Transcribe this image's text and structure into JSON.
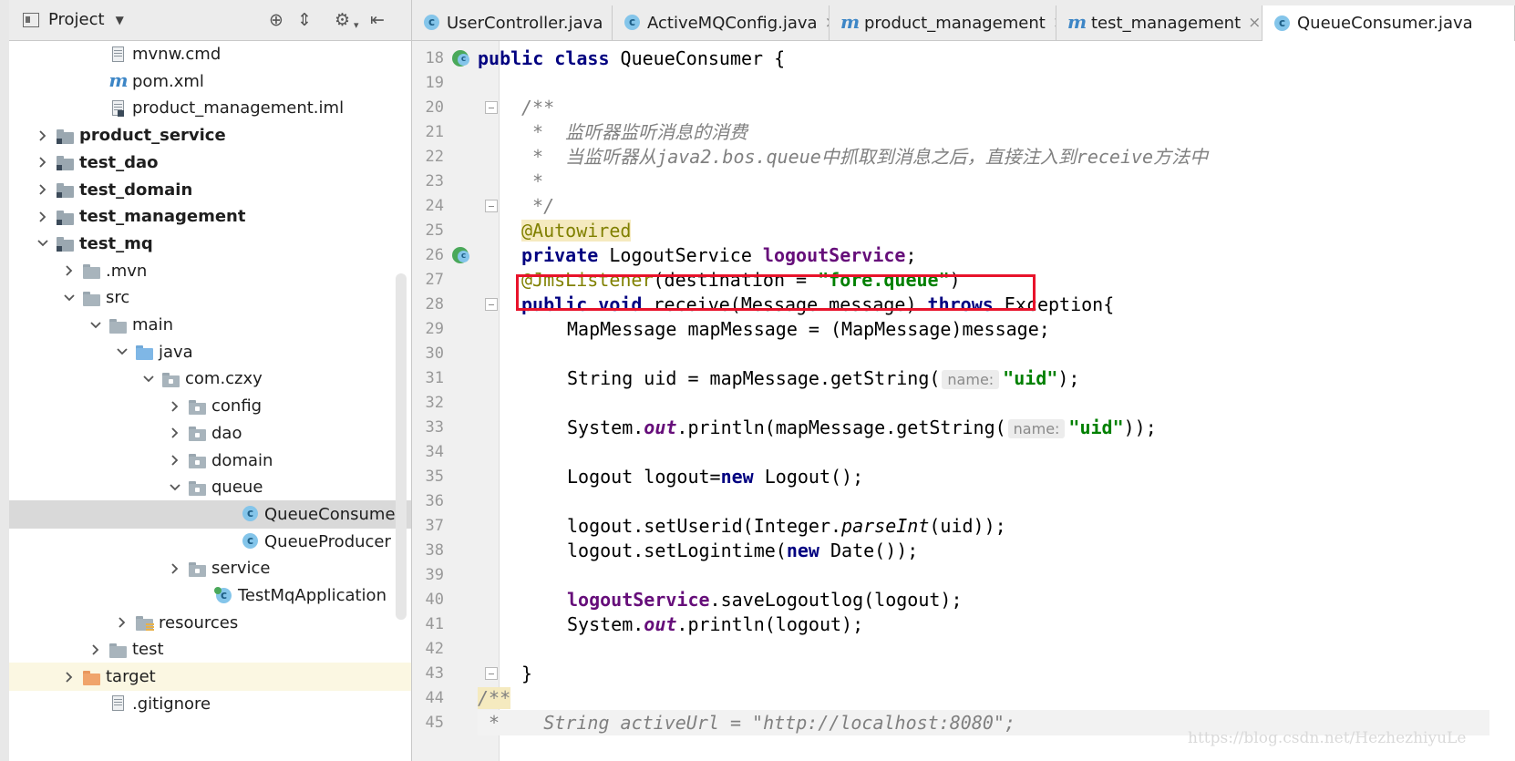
{
  "project_panel": {
    "title": "Project",
    "tree": [
      {
        "label": "mvnw.cmd",
        "icon": "file-icon"
      },
      {
        "label": "pom.xml",
        "icon": "maven-icon"
      },
      {
        "label": "product_management.iml",
        "icon": "iml-file-icon"
      },
      {
        "label": "product_service",
        "icon": "module-folder-icon"
      },
      {
        "label": "test_dao",
        "icon": "module-folder-icon"
      },
      {
        "label": "test_domain",
        "icon": "module-folder-icon"
      },
      {
        "label": "test_management",
        "icon": "module-folder-icon"
      },
      {
        "label": "test_mq",
        "icon": "module-folder-icon"
      },
      {
        "label": ".mvn",
        "icon": "folder-icon"
      },
      {
        "label": "src",
        "icon": "folder-icon"
      },
      {
        "label": "main",
        "icon": "folder-icon"
      },
      {
        "label": "java",
        "icon": "source-folder-icon"
      },
      {
        "label": "com.czxy",
        "icon": "package-icon"
      },
      {
        "label": "config",
        "icon": "package-icon"
      },
      {
        "label": "dao",
        "icon": "package-icon"
      },
      {
        "label": "domain",
        "icon": "package-icon"
      },
      {
        "label": "queue",
        "icon": "package-icon"
      },
      {
        "label": "QueueConsumer",
        "icon": "class-icon",
        "selected": true
      },
      {
        "label": "QueueProducer",
        "icon": "class-icon"
      },
      {
        "label": "service",
        "icon": "package-icon"
      },
      {
        "label": "TestMqApplication",
        "icon": "spring-boot-class-icon"
      },
      {
        "label": "resources",
        "icon": "resources-folder-icon"
      },
      {
        "label": "test",
        "icon": "folder-icon"
      },
      {
        "label": "target",
        "icon": "target-folder-icon"
      },
      {
        "label": ".gitignore",
        "icon": "file-icon"
      }
    ]
  },
  "tabs": [
    {
      "label": "UserController.java",
      "icon": "class-icon"
    },
    {
      "label": "ActiveMQConfig.java",
      "icon": "class-icon"
    },
    {
      "label": "product_management",
      "icon": "maven-icon"
    },
    {
      "label": "test_management",
      "icon": "maven-icon"
    },
    {
      "label": "QueueConsumer.java",
      "icon": "class-icon",
      "active": true
    }
  ],
  "editor": {
    "line_numbers": [
      "18",
      "19",
      "20",
      "21",
      "22",
      "23",
      "24",
      "25",
      "26",
      "27",
      "28",
      "29",
      "30",
      "31",
      "32",
      "33",
      "34",
      "35",
      "36",
      "37",
      "38",
      "39",
      "40",
      "41",
      "42",
      "43",
      "44",
      "45"
    ],
    "code": {
      "l18": {
        "k1": "public",
        "k2": "class",
        "rest": " QueueConsumer {"
      },
      "l20": "/**",
      "l21": " *  监听器监听消息的消费",
      "l22": " *  当监听器从java2.bos.queue中抓取到消息之后，直接注入到receive方法中",
      "l23": " *",
      "l24": " */",
      "l25": "@Autowired",
      "l26": {
        "k1": "private",
        "type": " LogoutService ",
        "field": "logoutService",
        "end": ";"
      },
      "l27": {
        "ann": "@JmsListener",
        "mid": "(destination = ",
        "str": "\"fore.queue\"",
        "end": ")"
      },
      "l28": {
        "k1": "public",
        "k2": "void",
        "mid": " receive(Message message) ",
        "k3": "throws",
        "end": " Exception{"
      },
      "l29": "MapMessage mapMessage = (MapMessage)message;",
      "l31": {
        "pre": "String uid = mapMessage.getString(",
        "hint": "name:",
        "str": "\"uid\"",
        "end": ");"
      },
      "l33": {
        "pre": "System.",
        "out": "out",
        "mid": ".println(mapMessage.getString(",
        "hint": "name:",
        "str": "\"uid\"",
        "end": "));"
      },
      "l35": {
        "pre": "Logout logout=",
        "k": "new",
        "end": " Logout();"
      },
      "l37": {
        "pre": "logout.setUserid(Integer.",
        "it": "parseInt",
        "end": "(uid));"
      },
      "l38": {
        "pre": "logout.setLogintime(",
        "k": "new",
        "end": " Date());"
      },
      "l40": {
        "field": "logoutService",
        "end": ".saveLogoutlog(logout);"
      },
      "l41": {
        "pre": "System.",
        "out": "out",
        "end": ".println(logout);"
      },
      "l43": "}",
      "l44": "/**",
      "l45": " *    String activeUrl = \"http://localhost:8080\";"
    }
  },
  "watermark": "https://blog.csdn.net/HezhezhiyuLe"
}
